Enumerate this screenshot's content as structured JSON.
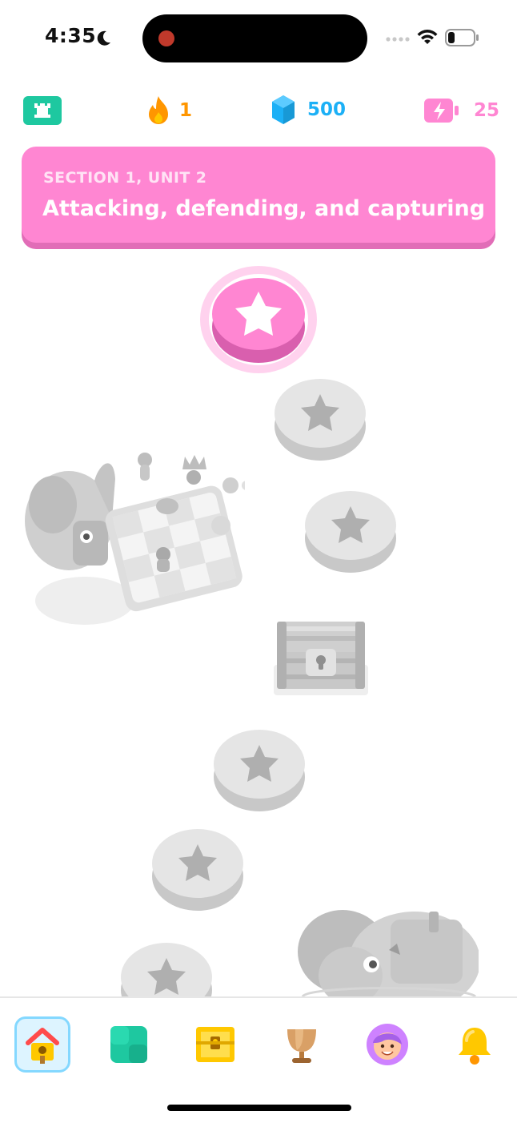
{
  "status_bar": {
    "time": "4:35"
  },
  "stats": {
    "streak": "1",
    "gems": "500",
    "energy": "25"
  },
  "banner": {
    "section_label": "SECTION 1, UNIT 2",
    "unit_title": "Attacking, defending, and capturing"
  },
  "colors": {
    "accent_pink": "#ff86d2",
    "locked_gray": "#e5e5e5",
    "gem_blue": "#1cb0f6",
    "streak_orange": "#ff9600",
    "energy_pink": "#ff86d2"
  },
  "path": {
    "nodes": [
      {
        "state": "active",
        "icon": "star-icon"
      },
      {
        "state": "locked",
        "icon": "star-icon"
      },
      {
        "state": "locked",
        "icon": "star-icon"
      },
      {
        "state": "locked",
        "icon": "treasure-chest-icon"
      },
      {
        "state": "locked",
        "icon": "star-icon"
      },
      {
        "state": "locked",
        "icon": "star-icon"
      },
      {
        "state": "locked",
        "icon": "star-icon"
      }
    ]
  },
  "tabs": [
    {
      "name": "home",
      "icon": "home-icon",
      "selected": true
    },
    {
      "name": "practice",
      "icon": "practice-grid-icon",
      "selected": false
    },
    {
      "name": "quests",
      "icon": "treasure-chest-icon",
      "selected": false
    },
    {
      "name": "leaderboard",
      "icon": "trophy-icon",
      "selected": false
    },
    {
      "name": "profile",
      "icon": "avatar-icon",
      "selected": false
    },
    {
      "name": "notifications",
      "icon": "bell-icon",
      "selected": false
    }
  ]
}
